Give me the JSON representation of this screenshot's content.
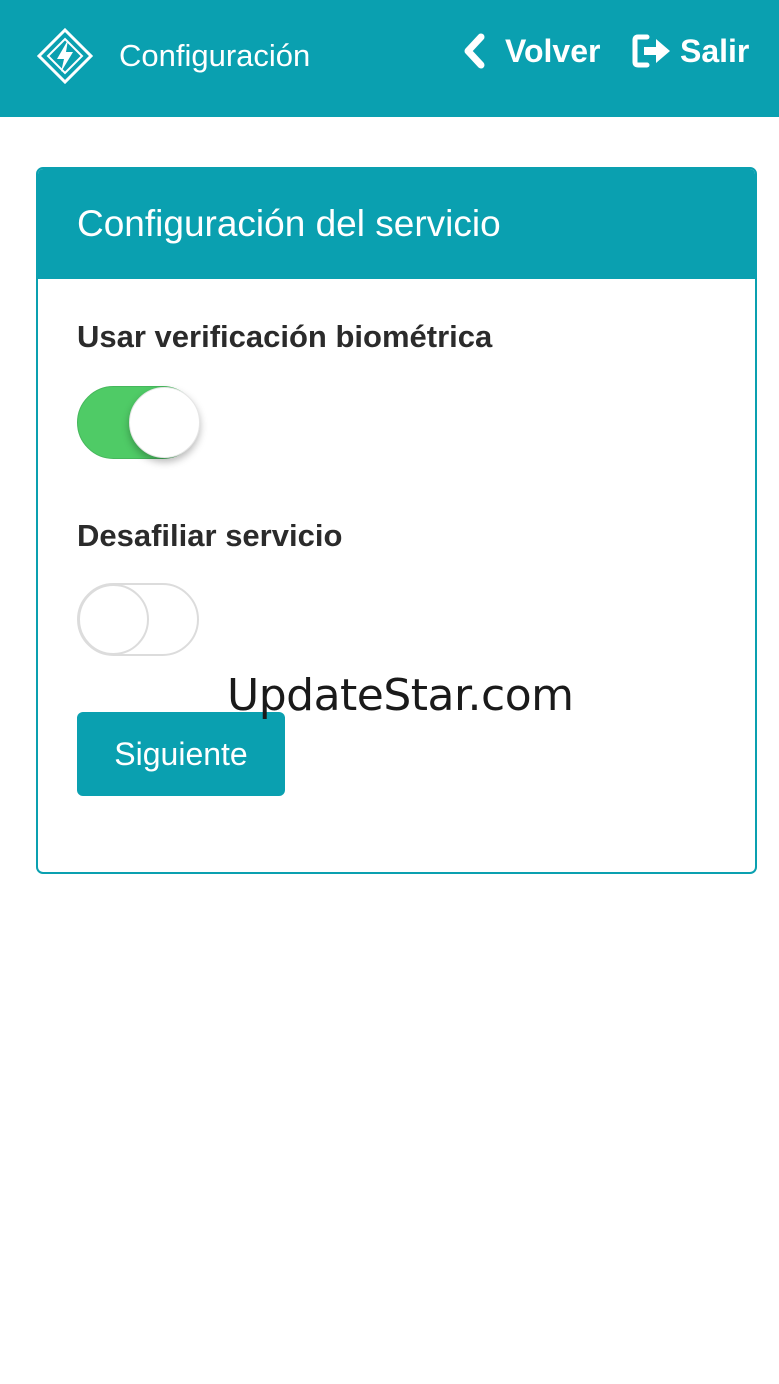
{
  "header": {
    "title": "Configuración",
    "back_label": "Volver",
    "exit_label": "Salir",
    "logo_icon": "diamond-bolt-icon",
    "back_icon": "chevron-left-icon",
    "exit_icon": "sign-out-icon",
    "background_color": "#0aa0b0"
  },
  "card": {
    "title": "Configuración del servicio",
    "fields": [
      {
        "label": "Usar verificación biométrica",
        "enabled": true
      },
      {
        "label": "Desafiliar servicio",
        "enabled": false
      }
    ],
    "next_label": "Siguiente",
    "toggle_on_color": "#4fcb66"
  },
  "watermark": "UpdateStar.com"
}
